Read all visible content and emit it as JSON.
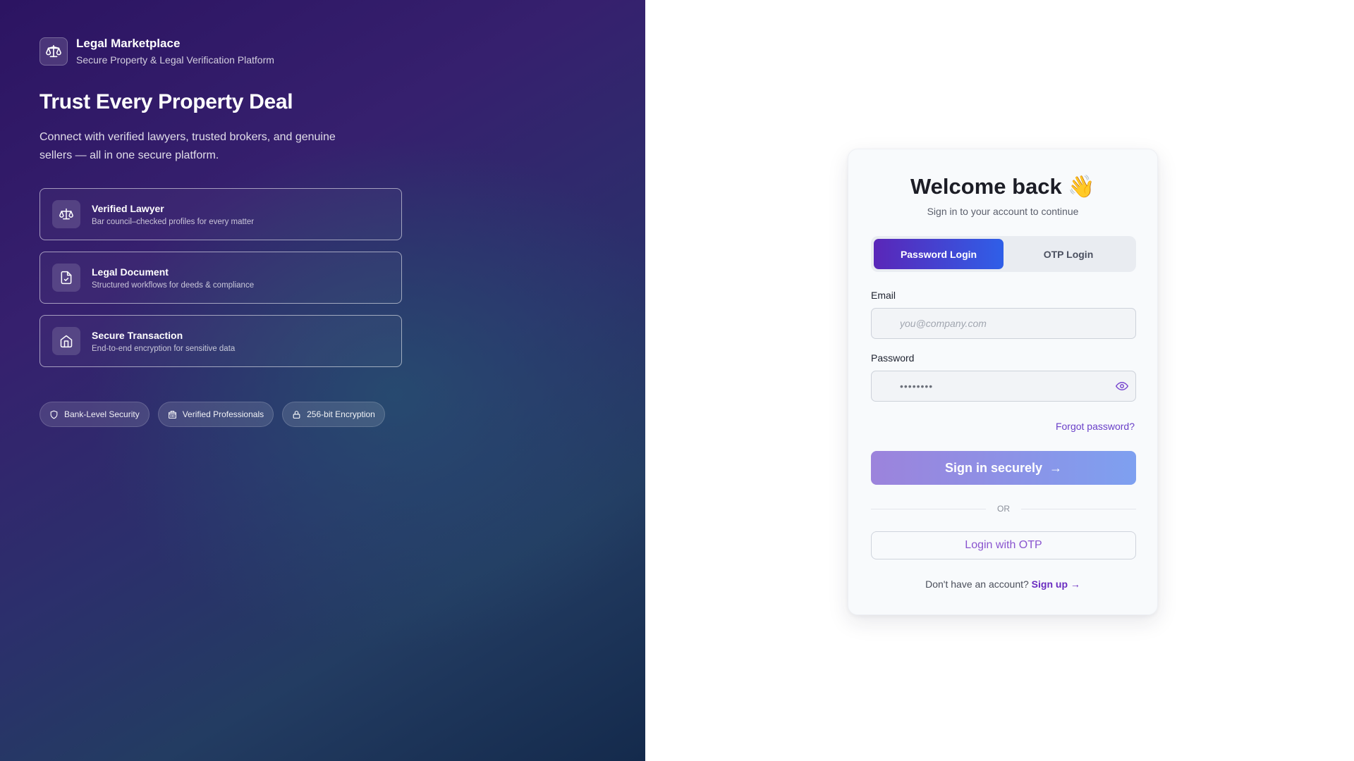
{
  "brand": {
    "name": "Legal Marketplace",
    "tagline": "Secure Property & Legal Verification Platform",
    "icon": "scale-icon"
  },
  "hero": {
    "headline": "Trust Every Property Deal",
    "lead": "Connect with verified lawyers, trusted brokers, and genuine sellers — all in one secure platform.",
    "features": [
      {
        "icon": "scale-icon",
        "title": "Verified Lawyer",
        "desc": "Bar council–checked profiles for every matter"
      },
      {
        "icon": "document-check-icon",
        "title": "Legal Document",
        "desc": "Structured workflows for deeds & compliance"
      },
      {
        "icon": "home-icon",
        "title": "Secure Transaction",
        "desc": "End-to-end encryption for sensitive data"
      }
    ],
    "pills": [
      {
        "icon": "shield-icon",
        "label": "Bank-Level Security"
      },
      {
        "icon": "building-icon",
        "label": "Verified Professionals"
      },
      {
        "icon": "lock-icon",
        "label": "256-bit Encryption"
      }
    ]
  },
  "login": {
    "title": "Welcome back 👋",
    "subtitle": "Sign in to your account to continue",
    "tabs": [
      {
        "label": "Password Login",
        "active": true
      },
      {
        "label": "OTP Login",
        "active": false
      }
    ],
    "email": {
      "label": "Email",
      "placeholder": "you@company.com",
      "value": ""
    },
    "password": {
      "label": "Password",
      "value_masked": "••••••••"
    },
    "forgot": "Forgot password?",
    "submit": "Sign in securely",
    "submit_arrow": "→",
    "divider": "OR",
    "otp_button": "Login with OTP",
    "signup_prompt": "Don't have an account?",
    "signup_link": "Sign up →"
  },
  "colors": {
    "accent_purple": "#5a26b8",
    "accent_blue": "#2f5fe8",
    "link": "#6a40c8"
  }
}
